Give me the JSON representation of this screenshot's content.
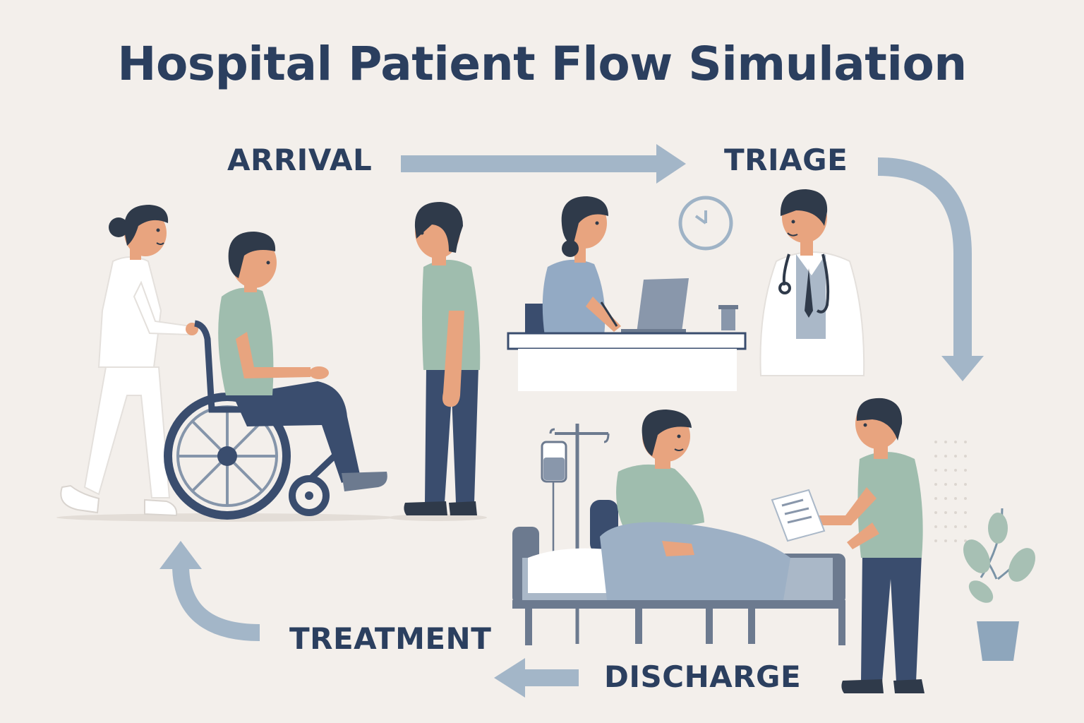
{
  "title": "Hospital Patient Flow Simulation",
  "stages": {
    "arrival": "ARRIVAL",
    "triage": "TRIAGE",
    "treatment": "TREATMENT",
    "discharge": "DISCHARGE"
  },
  "colors": {
    "background": "#f3efeb",
    "title_text": "#2b3f5f",
    "arrow": "#9fb3c6",
    "scrub_green": "#9fbdae",
    "navy": "#3a4d6e",
    "skin": "#e8a47f"
  },
  "icons": [
    "clock-icon",
    "stethoscope-icon",
    "iv-drip-icon",
    "potted-plant-icon",
    "wheelchair-icon",
    "laptop-icon",
    "document-icon"
  ]
}
